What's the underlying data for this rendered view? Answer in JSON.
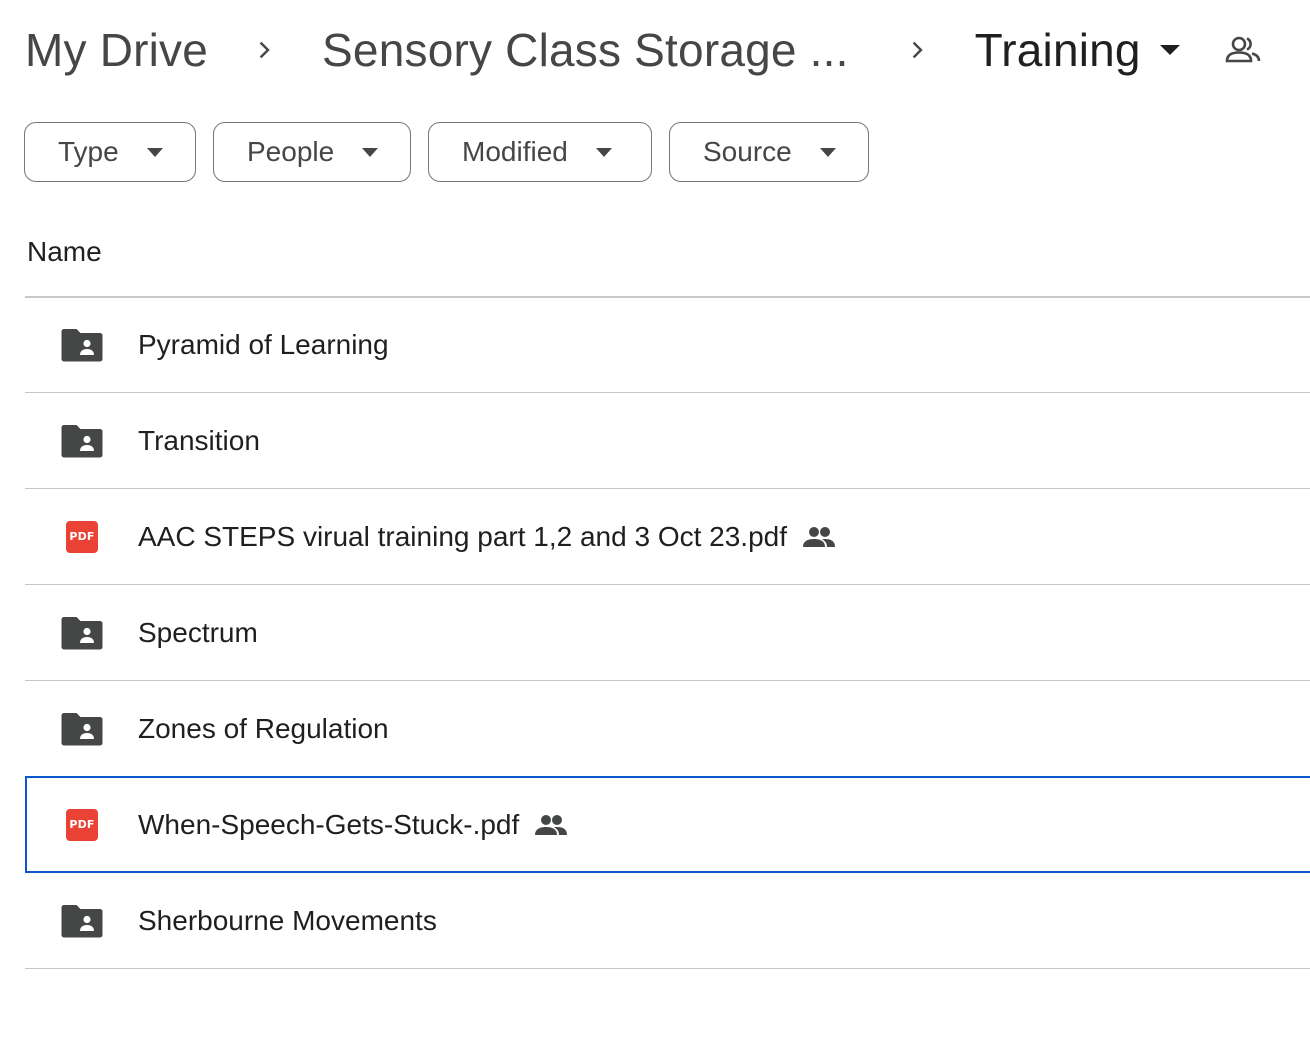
{
  "breadcrumb": {
    "items": [
      {
        "label": "My Drive"
      },
      {
        "label": "Sensory Class Storage ..."
      },
      {
        "label": "Training"
      }
    ]
  },
  "filters": {
    "chips": [
      {
        "label": "Type"
      },
      {
        "label": "People"
      },
      {
        "label": "Modified"
      },
      {
        "label": "Source"
      }
    ]
  },
  "list": {
    "column_header": "Name",
    "items": [
      {
        "name": "Pyramid of Learning",
        "type": "shared-folder",
        "shared": false,
        "selected": false
      },
      {
        "name": "Transition",
        "type": "shared-folder",
        "shared": false,
        "selected": false
      },
      {
        "name": "AAC STEPS virual training part 1,2 and 3 Oct 23.pdf",
        "type": "pdf",
        "shared": true,
        "selected": false
      },
      {
        "name": "Spectrum",
        "type": "shared-folder",
        "shared": false,
        "selected": false
      },
      {
        "name": "Zones of Regulation",
        "type": "shared-folder",
        "shared": false,
        "selected": false
      },
      {
        "name": "When-Speech-Gets-Stuck-.pdf",
        "type": "pdf",
        "shared": true,
        "selected": true
      },
      {
        "name": "Sherbourne Movements",
        "type": "shared-folder",
        "shared": false,
        "selected": false
      }
    ],
    "pdf_badge_text": "PDF"
  },
  "colors": {
    "selected_border": "#0b57d0",
    "pdf_red": "#ea4335",
    "folder_icon": "#444746",
    "divider": "#c7c7c7"
  }
}
